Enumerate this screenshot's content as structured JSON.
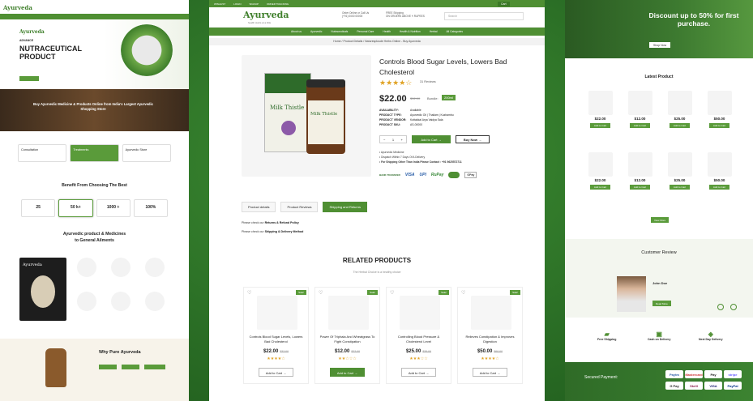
{
  "left": {
    "logo": "Ayurveda",
    "hero_small": "ADVANCE",
    "hero_title_1": "NUTRACEUTICAL",
    "hero_title_2": "PRODUCT",
    "banner_text": "Buy Ayurvedic Medicine & Products Online from India's Largest Ayurvedic Shopping Store",
    "cards": [
      "Consultation",
      "Treatments",
      "Ayurvedic Store"
    ],
    "benefit_title": "Benefit From Choosing The Best",
    "stats": [
      "25",
      "50 k+",
      "1000 +",
      "100%"
    ],
    "products_title_1": "Ayurvedic product & Medicines",
    "products_title_2": "to General Ailments",
    "why_title": "Why Pure Ayurveda"
  },
  "center": {
    "util": [
      "WISHLIST",
      "LOGIN",
      "SIGNUP",
      "ORDER TRACKING"
    ],
    "logo": "Ayurveda",
    "tagline": "health starts at a little",
    "order_line1": "Order Online or Call Us",
    "order_line2": "(+91) 0000 00000",
    "ship_line1": "FREE Shipping",
    "ship_line2": "ON ORDERS ABOVE ₹ RUPEES",
    "search_placeholder": "Search",
    "cart": "Cart",
    "nav": [
      "About us",
      "Ayurvedic",
      "Nutraceuticals",
      "Personal Care",
      "Health",
      "Health & Nutrition",
      "Herbal",
      "All Categories"
    ],
    "breadcrumb": "Home / Product Details / Naturesplusde Herbs Online - Buy Ayurveda",
    "title": "Controls Blood Sugar Levels, Lowers Bad Cholesterol",
    "stars": "★★★★☆",
    "reviews": "31 Reviews",
    "price": "$22.00",
    "old_price": "$32.00",
    "bundle_label": "Bundle:",
    "bundle_value": "200ml",
    "meta": [
      {
        "k": "AVAILABILITY:",
        "v": "Available"
      },
      {
        "k": "PRODUCT TYPE:",
        "v": "Ayurvedic Oil | Thailam | Kuzhambu"
      },
      {
        "k": "PRODUCT VENDOR:",
        "v": "Kottakkal Arya Vaidya Sala"
      },
      {
        "k": "PRODUCT SKU:",
        "v": "AS-00000"
      }
    ],
    "qty": "1",
    "add_to_cart": "Add to Cart",
    "buy_now": "Buy Now",
    "bullets": [
      "Ayurvedic Medicine",
      "Dispatch Within 7 Days Of A Delivery",
      "For Shipping Other Than India Please Contact : +91 9625572711"
    ],
    "payments": [
      "BANK TRANSFER",
      "VISA",
      "UPI",
      "RuPay",
      "MasterCard",
      "GPay"
    ],
    "tabs": [
      "Product details",
      "Product Reviews",
      "Shipping and Returns"
    ],
    "policy1_prefix": "Please check our",
    "policy1_link": "Returns & Refund Policy",
    "policy2_prefix": "Please check our",
    "policy2_link": "Shipping & Delivery Method",
    "related_title": "RELATED PRODUCTS",
    "related_sub": "The Herbal Choice is a healthy choice",
    "related": [
      {
        "name": "Controls Blood Sugar Levels, Lowers Bad Cholesterol",
        "price": "$22.00",
        "old": "$32.00",
        "stars": "★★★★☆",
        "btn": "Add to Cart",
        "sale": "Sale!"
      },
      {
        "name": "Power Of Triphala And Wheatgrass To Fight Constipation",
        "price": "$12.00",
        "old": "$22.00",
        "stars": "★★☆☆☆",
        "btn": "Add to Cart",
        "sale": "Sale!"
      },
      {
        "name": "Controlling Blood Pressure & Cholesterol Level",
        "price": "$25.00",
        "old": "$35.00",
        "stars": "★★★☆☆",
        "btn": "Add to Cart",
        "sale": "Sale!"
      },
      {
        "name": "Relieves Constipation & Improves Digestion",
        "price": "$50.00",
        "old": "$60.00",
        "stars": "★★★★☆",
        "btn": "Add to Cart",
        "sale": "Sale!"
      }
    ]
  },
  "right": {
    "hero_title": "Discount up to 50% for first purchase.",
    "hero_btn": "Shop Now",
    "latest_title": "Latest Product",
    "latest_items": [
      {
        "price": "$22.00",
        "btn": "Add to Cart"
      },
      {
        "price": "$12.00",
        "btn": "Add to Cart"
      },
      {
        "price": "$25.00",
        "btn": "Add to Cart"
      },
      {
        "price": "$50.00",
        "btn": "Add to Cart"
      },
      {
        "price": "$22.00",
        "btn": "Add to Cart"
      },
      {
        "price": "$12.00",
        "btn": "Add to Cart"
      },
      {
        "price": "$25.00",
        "btn": "Add to Cart"
      },
      {
        "price": "$50.00",
        "btn": "Add to Cart"
      }
    ],
    "view_more": "View More",
    "review_title": "Customer Review",
    "reviewer": "John Doe",
    "review_btn": "Read More",
    "features": [
      "Free Shipping",
      "Cash on Delivery",
      "Next Day Delivery"
    ],
    "secured": "Secured Payment:",
    "pay_icons": [
      "Paytm",
      "Mastercard",
      "Pay",
      "stripe",
      "G Pay",
      "Skrill",
      "VISA",
      "PayPal"
    ]
  }
}
